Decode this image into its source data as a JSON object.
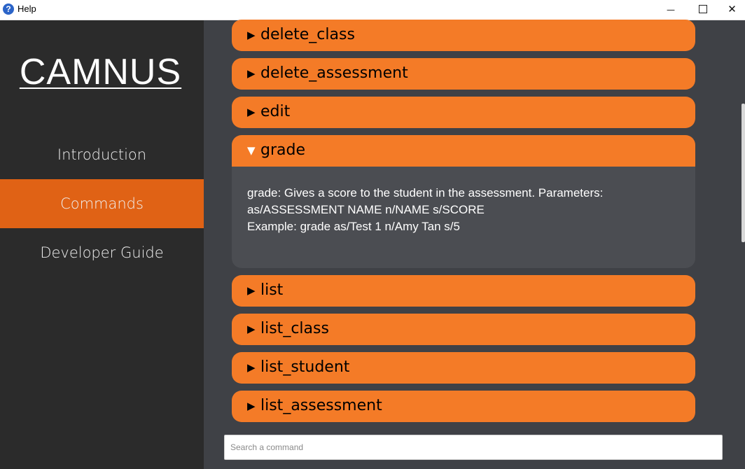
{
  "window": {
    "title": "Help",
    "app_icon": "?",
    "minimize_glyph": "—",
    "close_glyph": "✕"
  },
  "sidebar": {
    "brand": "CAMNUS",
    "items": [
      {
        "label": "Introduction",
        "selected": false
      },
      {
        "label": "Commands",
        "selected": true
      },
      {
        "label": "Developer Guide",
        "selected": false
      }
    ],
    "selected_color": "#e06215"
  },
  "commands": {
    "accent_color": "#f47b27",
    "collapsed_arrow": "▶",
    "expanded_arrow": "▼",
    "items": [
      {
        "label": "delete_class",
        "expanded": false
      },
      {
        "label": "delete_assessment",
        "expanded": false
      },
      {
        "label": "edit",
        "expanded": false
      },
      {
        "label": "grade",
        "expanded": true
      },
      {
        "label": "list",
        "expanded": false
      },
      {
        "label": "list_class",
        "expanded": false
      },
      {
        "label": "list_student",
        "expanded": false
      },
      {
        "label": "list_assessment",
        "expanded": false
      }
    ],
    "expanded_detail": {
      "line1": "grade: Gives a score to the student in the assessment. Parameters:",
      "line2": "as/ASSESSMENT NAME n/NAME s/SCORE",
      "line3": "Example: grade as/Test 1 n/Amy Tan s/5"
    }
  },
  "search": {
    "placeholder": "Search a command",
    "value": ""
  }
}
